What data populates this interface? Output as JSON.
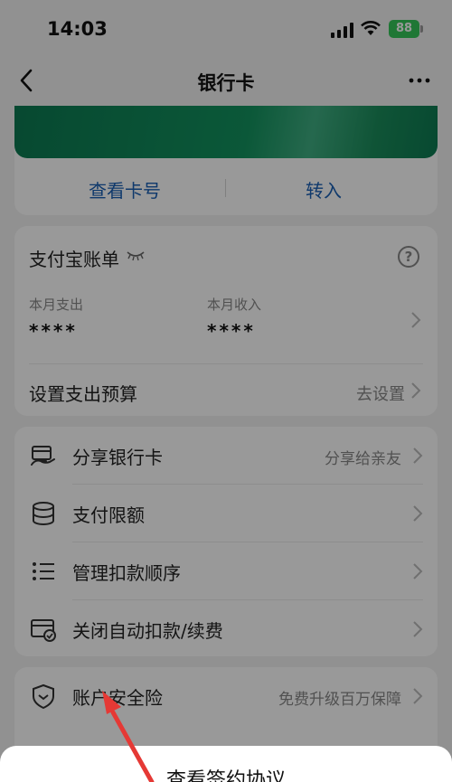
{
  "status_bar": {
    "time": "14:03",
    "battery": "88"
  },
  "nav": {
    "title": "银行卡"
  },
  "card": {
    "view_number": "查看卡号",
    "transfer_in": "转入"
  },
  "bill": {
    "title": "支付宝账单",
    "expense_label": "本月支出",
    "expense_value": "****",
    "income_label": "本月收入",
    "income_value": "****",
    "budget_label": "设置支出预算",
    "budget_action": "去设置"
  },
  "menu": {
    "items": [
      {
        "label": "分享银行卡",
        "extra": "分享给亲友",
        "icon": "share-card-icon"
      },
      {
        "label": "支付限额",
        "extra": "",
        "icon": "database-stack-icon"
      },
      {
        "label": "管理扣款顺序",
        "extra": "",
        "icon": "list-icon"
      },
      {
        "label": "关闭自动扣款/续费",
        "extra": "",
        "icon": "auto-pay-card-icon"
      }
    ]
  },
  "insurance": {
    "label": "账户安全险",
    "extra": "免费升级百万保障"
  },
  "sheet": {
    "title": "查看签约协议"
  },
  "colors": {
    "card_green": "#13935f",
    "link_blue": "#1a5fb4",
    "arrow_red": "#e53935",
    "battery_green": "#34c759"
  }
}
